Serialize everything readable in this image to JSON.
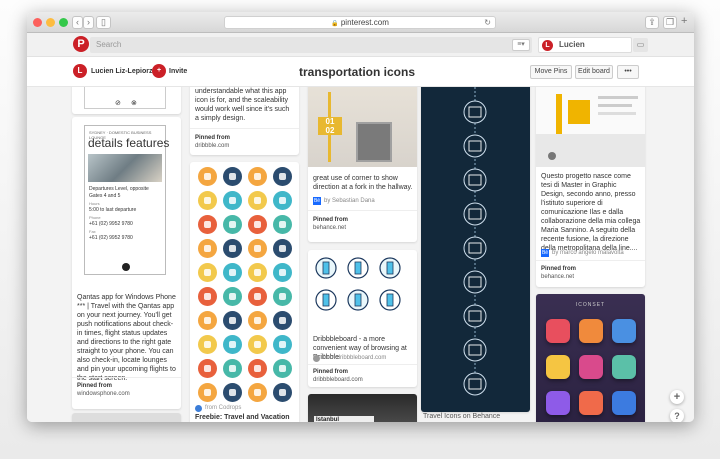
{
  "browser": {
    "url": "pinterest.com"
  },
  "topbar": {
    "search_placeholder": "Search",
    "user": "Lucien"
  },
  "board": {
    "owner": "Lucien Liz-Lepiorz",
    "invite": "Invite",
    "title": "transportation icons",
    "move_pins": "Move Pins",
    "edit_board": "Edit board",
    "more": "•••"
  },
  "col1": {
    "card_title": "details  features",
    "line1": "Departures Level, opposite",
    "line2": "Gates 4 and 5",
    "line3": "Hours",
    "line4": "5:00 to last departure",
    "line5": "Phone",
    "line6": "+61 (02) 9952 9780",
    "line7": "Fax",
    "line8": "+61 (02) 9952 9780",
    "desc": "Qantas app for Windows Phone *** | Travel with the Qantas app on your next journey. You'll get push notifications about check-in times, flight status updates and directions to the right gate straight to your phone. You can also check-in, locate lounges and pin your upcoming flights to the start screen.",
    "pinned_from": "Pinned from",
    "source": "windowsphone.com",
    "header_small": "SYDNEY · DOMESTIC BUSINESS LOUNGE"
  },
  "col2": {
    "desc1": "understandable what this app icon is for, and the scaleability would work well since it's such a simply design.",
    "pinned_from": "Pinned from",
    "source": "dribbble.com",
    "from2": "from Codrops",
    "title2": "Freebie: Travel and Vacation"
  },
  "col3": {
    "desc1": "great use of corner to show direction at a fork in the hallway.",
    "by1": "by Sebastian Dana",
    "pinned_from": "Pinned from",
    "source1": "behance.net",
    "desc2": "Dribbbleboard - a more convenient way of browsing at Dribbble",
    "from2": "from dribbbleboard.com",
    "source2": "dribbbleboard.com"
  },
  "col4": {
    "caption": "Travel Icons on Behance"
  },
  "col5": {
    "desc": "Questo progetto nasce come tesi di Master in Graphic Design, secondo anno, presso l'istituto superiore di comunicazione Ilas e dalla collaborazione della mia collega Maria Sannino. A seguito della recente fusione, la direzione della metropolitana della line....",
    "by": "by marco angelo malavolta",
    "pinned_from": "Pinned from",
    "source": "behance.net",
    "iconset": "ICONSET"
  },
  "fab": {
    "add": "+",
    "help": "?"
  },
  "colors": {
    "pinterest_red": "#cb2027",
    "navy": "#12283a"
  }
}
